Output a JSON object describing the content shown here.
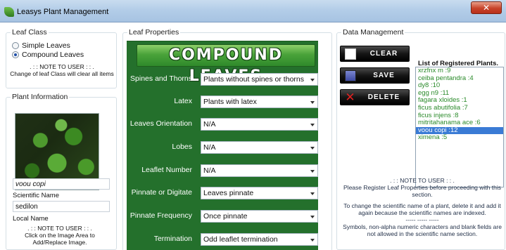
{
  "window": {
    "title": "Leasys Plant Management",
    "close_icon": "close-icon"
  },
  "leaf_class": {
    "group_title": "Leaf Class",
    "options": [
      {
        "label": "Simple Leaves",
        "checked": false
      },
      {
        "label": "Compound Leaves",
        "checked": true
      }
    ],
    "note_heading": ". : : NOTE TO USER : : .",
    "note_text": "Change of leaf Class will clear all items"
  },
  "plant_info": {
    "group_title": "Plant Information",
    "image_label": "voou copi",
    "scientific_name_label": "Scientific Name",
    "scientific_name_value": "sedilon",
    "local_name_label": "Local Name",
    "note_heading": ". : : NOTE TO USER : : .",
    "note_text": "Click on the Image Area to Add/Replace Image."
  },
  "leaf_properties": {
    "group_title": "Leaf Properties",
    "banner": "COMPOUND LEAVES",
    "accent_color": "#24702c",
    "fields": [
      {
        "label": "Spines and Thorns",
        "value": "Plants without spines or thorns"
      },
      {
        "label": "Latex",
        "value": "Plants with latex"
      },
      {
        "label": "Leaves Orientation",
        "value": "N/A"
      },
      {
        "label": "Lobes",
        "value": "N/A"
      },
      {
        "label": "Leaflet Number",
        "value": "N/A"
      },
      {
        "label": "Pinnate or Digitate",
        "value": "Leaves pinnate"
      },
      {
        "label": "Pinnate Frequency",
        "value": "Once pinnate"
      },
      {
        "label": "Termination",
        "value": "Odd leaflet termination"
      }
    ]
  },
  "data_management": {
    "group_title": "Data Management",
    "buttons": [
      {
        "label": "CLEAR",
        "icon": "blank-page-icon"
      },
      {
        "label": "SAVE",
        "icon": "floppy-disk-icon"
      },
      {
        "label": "DELETE",
        "icon": "red-x-icon"
      }
    ],
    "list_title": "List of Registered Plants.",
    "plants": [
      {
        "label": "xrzfnx m :9",
        "selected": false
      },
      {
        "label": "ceiba pentandra :4",
        "selected": false
      },
      {
        "label": "dy8 :10",
        "selected": false
      },
      {
        "label": "egg n9 :11",
        "selected": false
      },
      {
        "label": "fagara xloides :1",
        "selected": false
      },
      {
        "label": "ficus abutifolia :7",
        "selected": false
      },
      {
        "label": "ficus injens :8",
        "selected": false
      },
      {
        "label": "mitritahanama ace :6",
        "selected": false
      },
      {
        "label": "voou copi :12",
        "selected": true
      },
      {
        "label": "ximena :5",
        "selected": false
      }
    ],
    "note_heading": ". : : NOTE TO USER : : .",
    "note_1": "Please Register Leaf Properties before proceeding with this section.",
    "note_2": "To change the scientific name of a plant, delete it and add it again because the scientific names are indexed.",
    "separator": "----- ----- -----",
    "note_3": "Symbols, non-alpha numeric characters and blank fields are not allowed in the scientific name section."
  }
}
